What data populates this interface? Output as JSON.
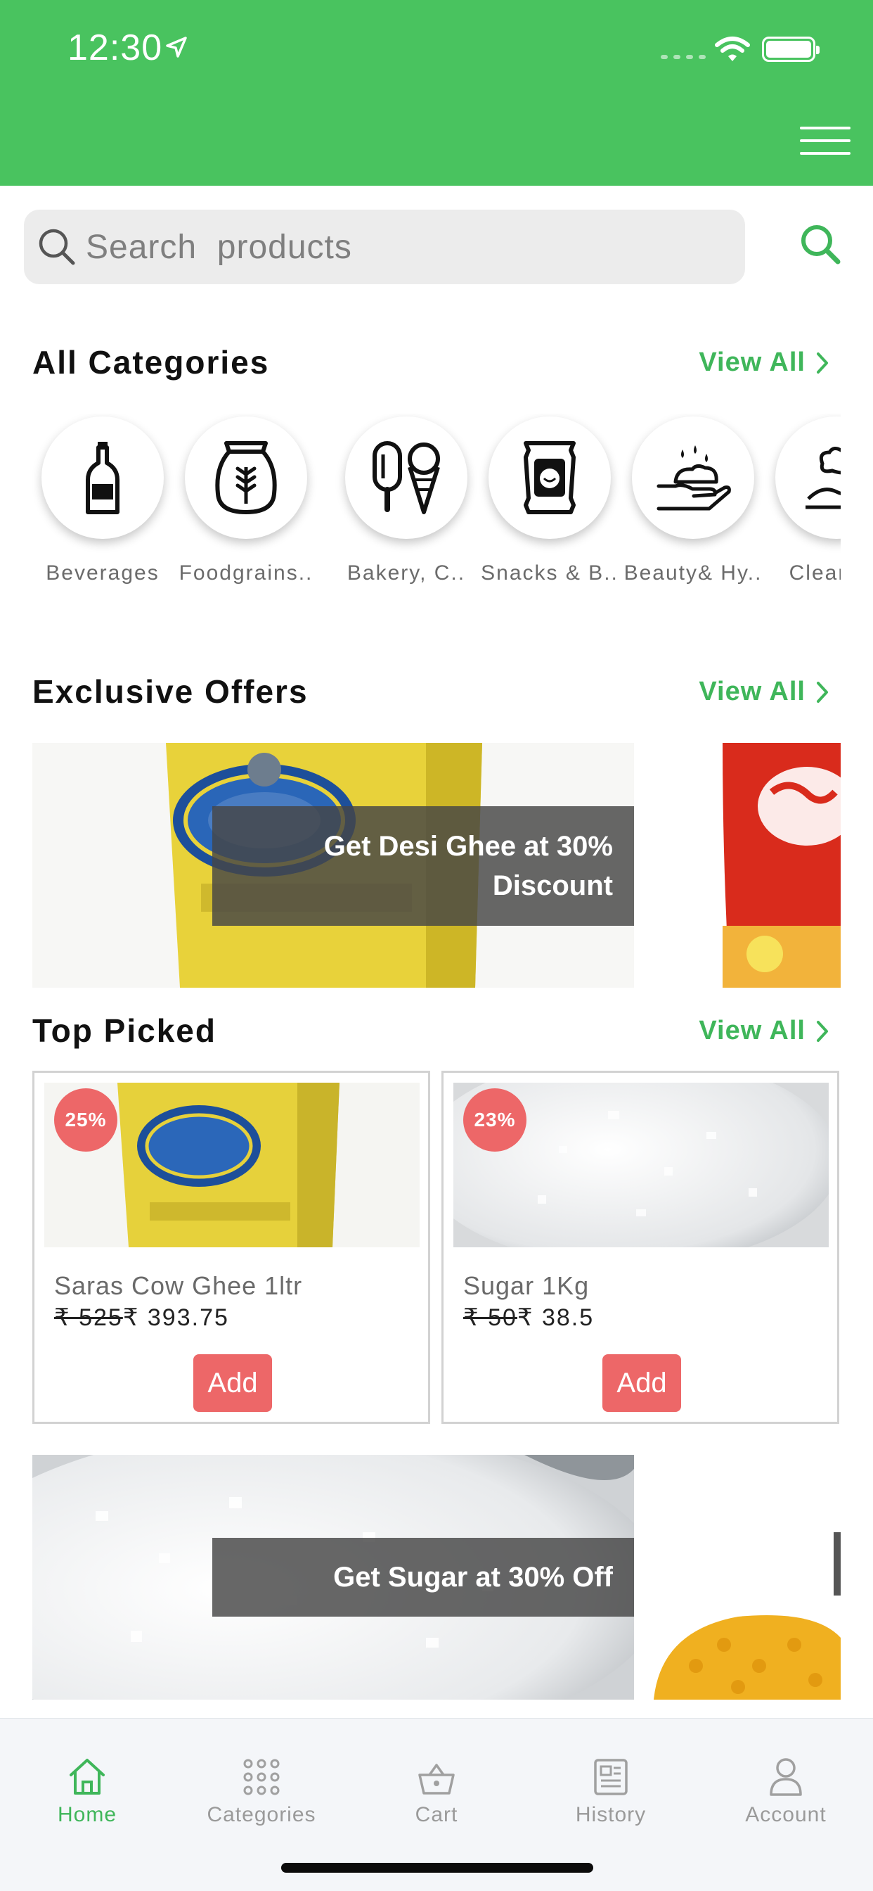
{
  "status_bar": {
    "time": "12:30"
  },
  "search": {
    "placeholder": "Search  products"
  },
  "categories_section": {
    "title": "All Categories",
    "view_all": "View All",
    "items": [
      {
        "label": "Beverages",
        "icon": "bottle-icon"
      },
      {
        "label": "Foodgrains..",
        "icon": "grain-sack-icon"
      },
      {
        "label": "Bakery, C..",
        "icon": "ice-cream-icon"
      },
      {
        "label": "Snacks & B..",
        "icon": "snack-packet-icon"
      },
      {
        "label": "Beauty& Hy..",
        "icon": "soap-hand-icon"
      },
      {
        "label": "Clear &..",
        "icon": "cleaning-icon"
      }
    ]
  },
  "offers_section": {
    "title": "Exclusive Offers",
    "view_all": "View All",
    "banners": [
      {
        "caption": "Get Desi Ghee at 30% Discount"
      }
    ]
  },
  "top_picked": {
    "title": "Top Picked",
    "view_all": "View All",
    "products": [
      {
        "discount": "25%",
        "name": "Saras Cow Ghee 1ltr",
        "old_price": "₹ 525",
        "price": "₹ 393.75",
        "add_label": "Add"
      },
      {
        "discount": "23%",
        "name": "Sugar 1Kg",
        "old_price": "₹ 50",
        "price": "₹ 38.5",
        "add_label": "Add"
      }
    ]
  },
  "promo_banners": [
    {
      "caption": "Get Sugar at 30% Off"
    }
  ],
  "tabbar": {
    "items": [
      {
        "label": "Home",
        "icon": "home-icon",
        "active": true
      },
      {
        "label": "Categories",
        "icon": "grid-icon",
        "active": false
      },
      {
        "label": "Cart",
        "icon": "basket-icon",
        "active": false
      },
      {
        "label": "History",
        "icon": "newspaper-icon",
        "active": false
      },
      {
        "label": "Account",
        "icon": "user-icon",
        "active": false
      }
    ]
  },
  "colors": {
    "brand_green": "#49c35f",
    "accent_red": "#ed6768",
    "link_green": "#3fb65a"
  }
}
